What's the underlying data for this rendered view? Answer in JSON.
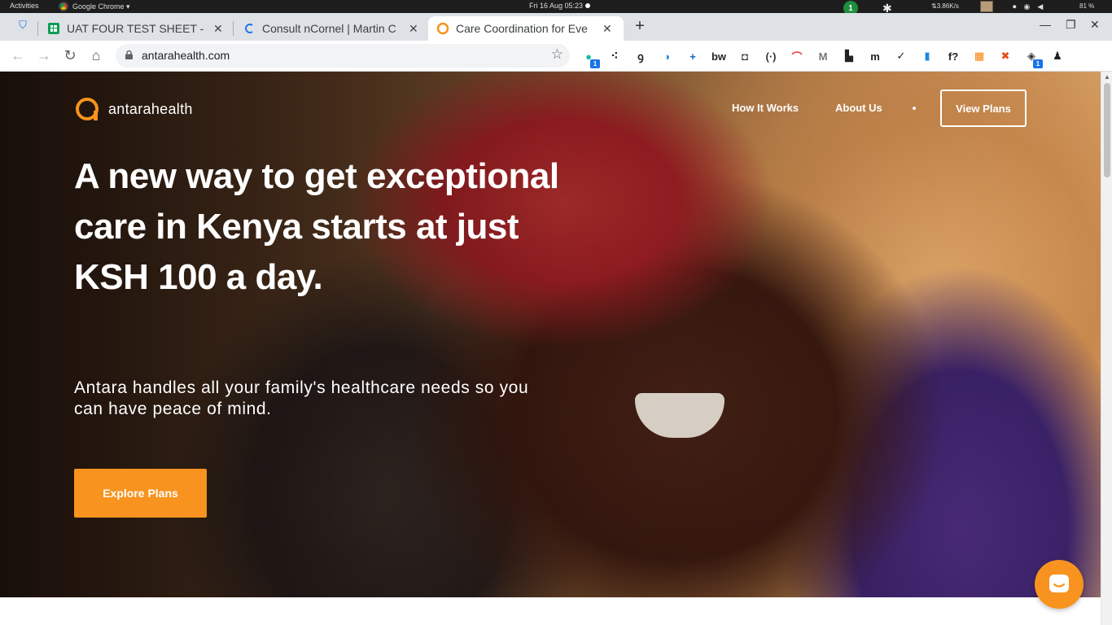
{
  "system_bar": {
    "activities": "Activities",
    "app_name": "Google Chrome ▾",
    "clock": "Fri 16 Aug  05:23",
    "notification_count": "1",
    "net_speed": "⇅3.86K/s",
    "battery": "81 %"
  },
  "tabs": [
    {
      "label": "UAT FOUR TEST SHEET - G",
      "active": false
    },
    {
      "label": "Consult nCornel | Martin C",
      "active": false
    },
    {
      "label": "Care Coordination for Eve",
      "active": true
    }
  ],
  "new_tab_label": "+",
  "window_controls": {
    "minimize": "—",
    "restore": "❐",
    "close": "✕"
  },
  "toolbar": {
    "url": "antarahealth.com",
    "extensions": [
      {
        "name": "grammarly-extension",
        "glyph": "●",
        "color": "#15c39a",
        "badge": "1"
      },
      {
        "name": "dots-extension",
        "glyph": "⁖",
        "color": "#222",
        "badge": ""
      },
      {
        "name": "gnome-extension",
        "glyph": "ꝯ",
        "color": "#222",
        "badge": ""
      },
      {
        "name": "speed-extension",
        "glyph": "◑",
        "color": "#1e88e5",
        "badge": ""
      },
      {
        "name": "plus-extension",
        "glyph": "+",
        "color": "#1565c0",
        "badge": ""
      },
      {
        "name": "bw-extension",
        "glyph": "bw",
        "color": "#222",
        "badge": ""
      },
      {
        "name": "note-extension",
        "glyph": "◘",
        "color": "#333",
        "badge": ""
      },
      {
        "name": "code-extension",
        "glyph": "(·)",
        "color": "#333",
        "badge": ""
      },
      {
        "name": "rainbow-extension",
        "glyph": "⌒",
        "color": "#e53935",
        "badge": ""
      },
      {
        "name": "m-circle-extension",
        "glyph": "M",
        "color": "#777",
        "badge": ""
      },
      {
        "name": "doc-extension",
        "glyph": "▙",
        "color": "#222",
        "badge": ""
      },
      {
        "name": "m-italic-extension",
        "glyph": "m",
        "color": "#222",
        "badge": ""
      },
      {
        "name": "check-extension",
        "glyph": "✓",
        "color": "#222",
        "badge": ""
      },
      {
        "name": "bookmark-extension",
        "glyph": "▮",
        "color": "#1e88e5",
        "badge": ""
      },
      {
        "name": "formula-extension",
        "glyph": "f?",
        "color": "#222",
        "badge": ""
      },
      {
        "name": "grid-extension",
        "glyph": "▦",
        "color": "#f57c00",
        "badge": ""
      },
      {
        "name": "stop-extension",
        "glyph": "✖",
        "color": "#e64a19",
        "badge": ""
      },
      {
        "name": "box-extension",
        "glyph": "◈",
        "color": "#333",
        "badge": "1"
      },
      {
        "name": "profile-extension",
        "glyph": "♟",
        "color": "#222",
        "badge": ""
      }
    ]
  },
  "site": {
    "logo_text": "antarahealth",
    "nav": {
      "how_it_works": "How It Works",
      "about_us": "About Us",
      "view_plans": "View Plans"
    },
    "headline": "A new way to get exceptional care in Kenya starts at just KSH 100 a day.",
    "subheadline": "Antara handles all your family's healthcare needs so you can have peace of mind.",
    "cta": "Explore Plans"
  },
  "colors": {
    "brand_orange": "#f7931e",
    "tab_strip": "#dee1e6"
  }
}
